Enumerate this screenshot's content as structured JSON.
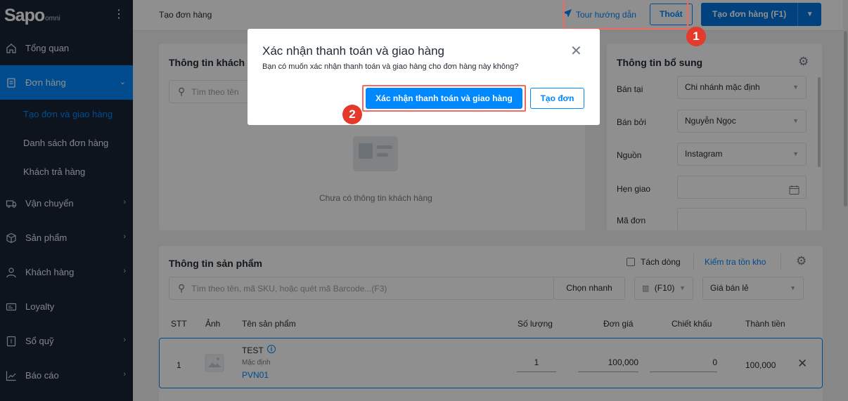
{
  "app": {
    "logo": "Sapo",
    "logo_sub": "omni"
  },
  "sidebar": {
    "items": [
      {
        "label": "Tổng quan"
      },
      {
        "label": "Đơn hàng"
      },
      {
        "label": "Vận chuyển"
      },
      {
        "label": "Sản phẩm"
      },
      {
        "label": "Khách hàng"
      },
      {
        "label": "Loyalty"
      },
      {
        "label": "Sổ quỹ"
      },
      {
        "label": "Báo cáo"
      }
    ],
    "sub_items": [
      {
        "label": "Tạo đơn và giao hàng"
      },
      {
        "label": "Danh sách đơn hàng"
      },
      {
        "label": "Khách trả hàng"
      }
    ]
  },
  "topbar": {
    "breadcrumb": "Tạo đơn hàng",
    "tour_label": "Tour hướng dẫn",
    "exit_label": "Thoát",
    "create_label": "Tạo đơn hàng (F1)"
  },
  "customer": {
    "title": "Thông tin khách h",
    "search_placeholder": "Tìm theo tên",
    "empty_text": "Chưa có thông tin khách hàng"
  },
  "extra": {
    "title": "Thông tin bổ sung",
    "fields": [
      {
        "label": "Bán tại",
        "value": "Chi nhánh mặc định"
      },
      {
        "label": "Bán bởi",
        "value": "Nguyễn Ngọc"
      },
      {
        "label": "Nguồn",
        "value": "Instagram"
      },
      {
        "label": "Hẹn giao",
        "value": ""
      },
      {
        "label": "Mã đơn",
        "value": ""
      }
    ]
  },
  "products": {
    "title": "Thông tin sản phẩm",
    "split_label": "Tách dòng",
    "check_stock_label": "Kiểm tra tồn kho",
    "search_placeholder": "Tìm theo tên, mã SKU, hoặc quét mã Barcode...(F3)",
    "quick_pick_label": "Chọn nhanh",
    "barcode_label": "(F10)",
    "price_type": "Giá bán lẻ",
    "columns": [
      "STT",
      "Ảnh",
      "Tên sản phẩm",
      "Số lượng",
      "Đơn giá",
      "Chiết khấu",
      "Thành tiền"
    ],
    "rows": [
      {
        "stt": "1",
        "name": "TEST",
        "variant": "Mặc định",
        "sku": "PVN01",
        "qty": "1",
        "price": "100,000",
        "discount": "0",
        "total": "100,000"
      }
    ]
  },
  "modal": {
    "title": "Xác nhận thanh toán và giao hàng",
    "description": "Bạn có muốn xác nhận thanh toán và giao hàng cho đơn hàng này không?",
    "confirm_label": "Xác nhận thanh toán và giao hàng",
    "create_only_label": "Tạo đơn"
  },
  "annotations": {
    "step1": "1",
    "step2": "2"
  },
  "colors": {
    "primary": "#0088ff",
    "sidebar": "#182537",
    "highlight": "#f06a5f",
    "badge": "#e43a2c"
  }
}
